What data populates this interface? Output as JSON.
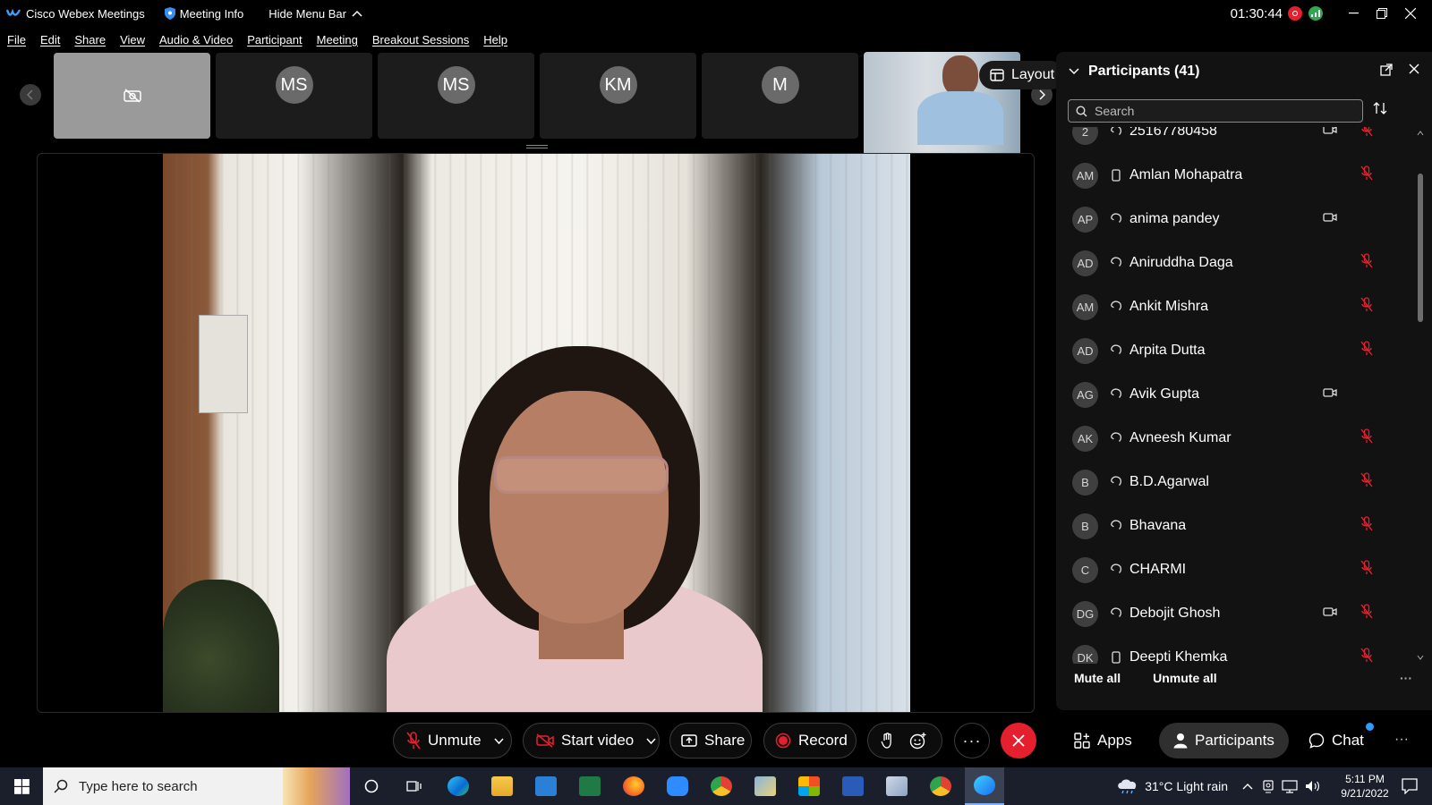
{
  "window": {
    "app_title": "Cisco Webex Meetings",
    "meeting_info": "Meeting Info",
    "hide_menu": "Hide Menu Bar",
    "timer": "01:30:44"
  },
  "menu": [
    "File",
    "Edit",
    "Share",
    "View",
    "Audio & Video",
    "Participant",
    "Meeting",
    "Breakout Sessions",
    "Help"
  ],
  "thumbnails": [
    {
      "initials": "",
      "type": "video-off"
    },
    {
      "initials": "MS",
      "type": "avatar"
    },
    {
      "initials": "MS",
      "type": "avatar"
    },
    {
      "initials": "KM",
      "type": "avatar"
    },
    {
      "initials": "M",
      "type": "avatar"
    },
    {
      "initials": "",
      "type": "video"
    }
  ],
  "layout_label": "Layout",
  "participants_panel": {
    "title": "Participants (41)",
    "search_placeholder": "Search",
    "rows": [
      {
        "initials": "2",
        "name": "25167780458",
        "device": "headset",
        "camera": true,
        "mic_muted": true
      },
      {
        "initials": "AM",
        "name": "Amlan Mohapatra",
        "device": "phone",
        "camera": false,
        "mic_muted": true
      },
      {
        "initials": "AP",
        "name": "anima pandey",
        "device": "headset",
        "camera": true,
        "mic_muted": false
      },
      {
        "initials": "AD",
        "name": "Aniruddha Daga",
        "device": "headset",
        "camera": false,
        "mic_muted": true
      },
      {
        "initials": "AM",
        "name": "Ankit Mishra",
        "device": "headset",
        "camera": false,
        "mic_muted": true
      },
      {
        "initials": "AD",
        "name": "Arpita Dutta",
        "device": "headset",
        "camera": false,
        "mic_muted": true
      },
      {
        "initials": "AG",
        "name": "Avik Gupta",
        "device": "headset",
        "camera": true,
        "mic_muted": false
      },
      {
        "initials": "AK",
        "name": "Avneesh Kumar",
        "device": "headset",
        "camera": false,
        "mic_muted": true
      },
      {
        "initials": "B",
        "name": "B.D.Agarwal",
        "device": "headset",
        "camera": false,
        "mic_muted": true
      },
      {
        "initials": "B",
        "name": "Bhavana",
        "device": "headset",
        "camera": false,
        "mic_muted": true
      },
      {
        "initials": "C",
        "name": "CHARMI",
        "device": "headset",
        "camera": false,
        "mic_muted": true
      },
      {
        "initials": "DG",
        "name": "Debojit Ghosh",
        "device": "headset",
        "camera": true,
        "mic_muted": true
      },
      {
        "initials": "DK",
        "name": "Deepti Khemka",
        "device": "phone",
        "camera": false,
        "mic_muted": true
      }
    ],
    "mute_all": "Mute all",
    "unmute_all": "Unmute all"
  },
  "controls": {
    "unmute": "Unmute",
    "start_video": "Start video",
    "share": "Share",
    "record": "Record",
    "apps": "Apps",
    "participants": "Participants",
    "chat": "Chat"
  },
  "taskbar": {
    "search_placeholder": "Type here to search",
    "weather": "31°C  Light rain",
    "time": "5:11 PM",
    "date": "9/21/2022"
  },
  "colors": {
    "end_meeting": "#e5202e",
    "record_dot": "#e5202e",
    "chat_badge": "#2f9bff"
  }
}
